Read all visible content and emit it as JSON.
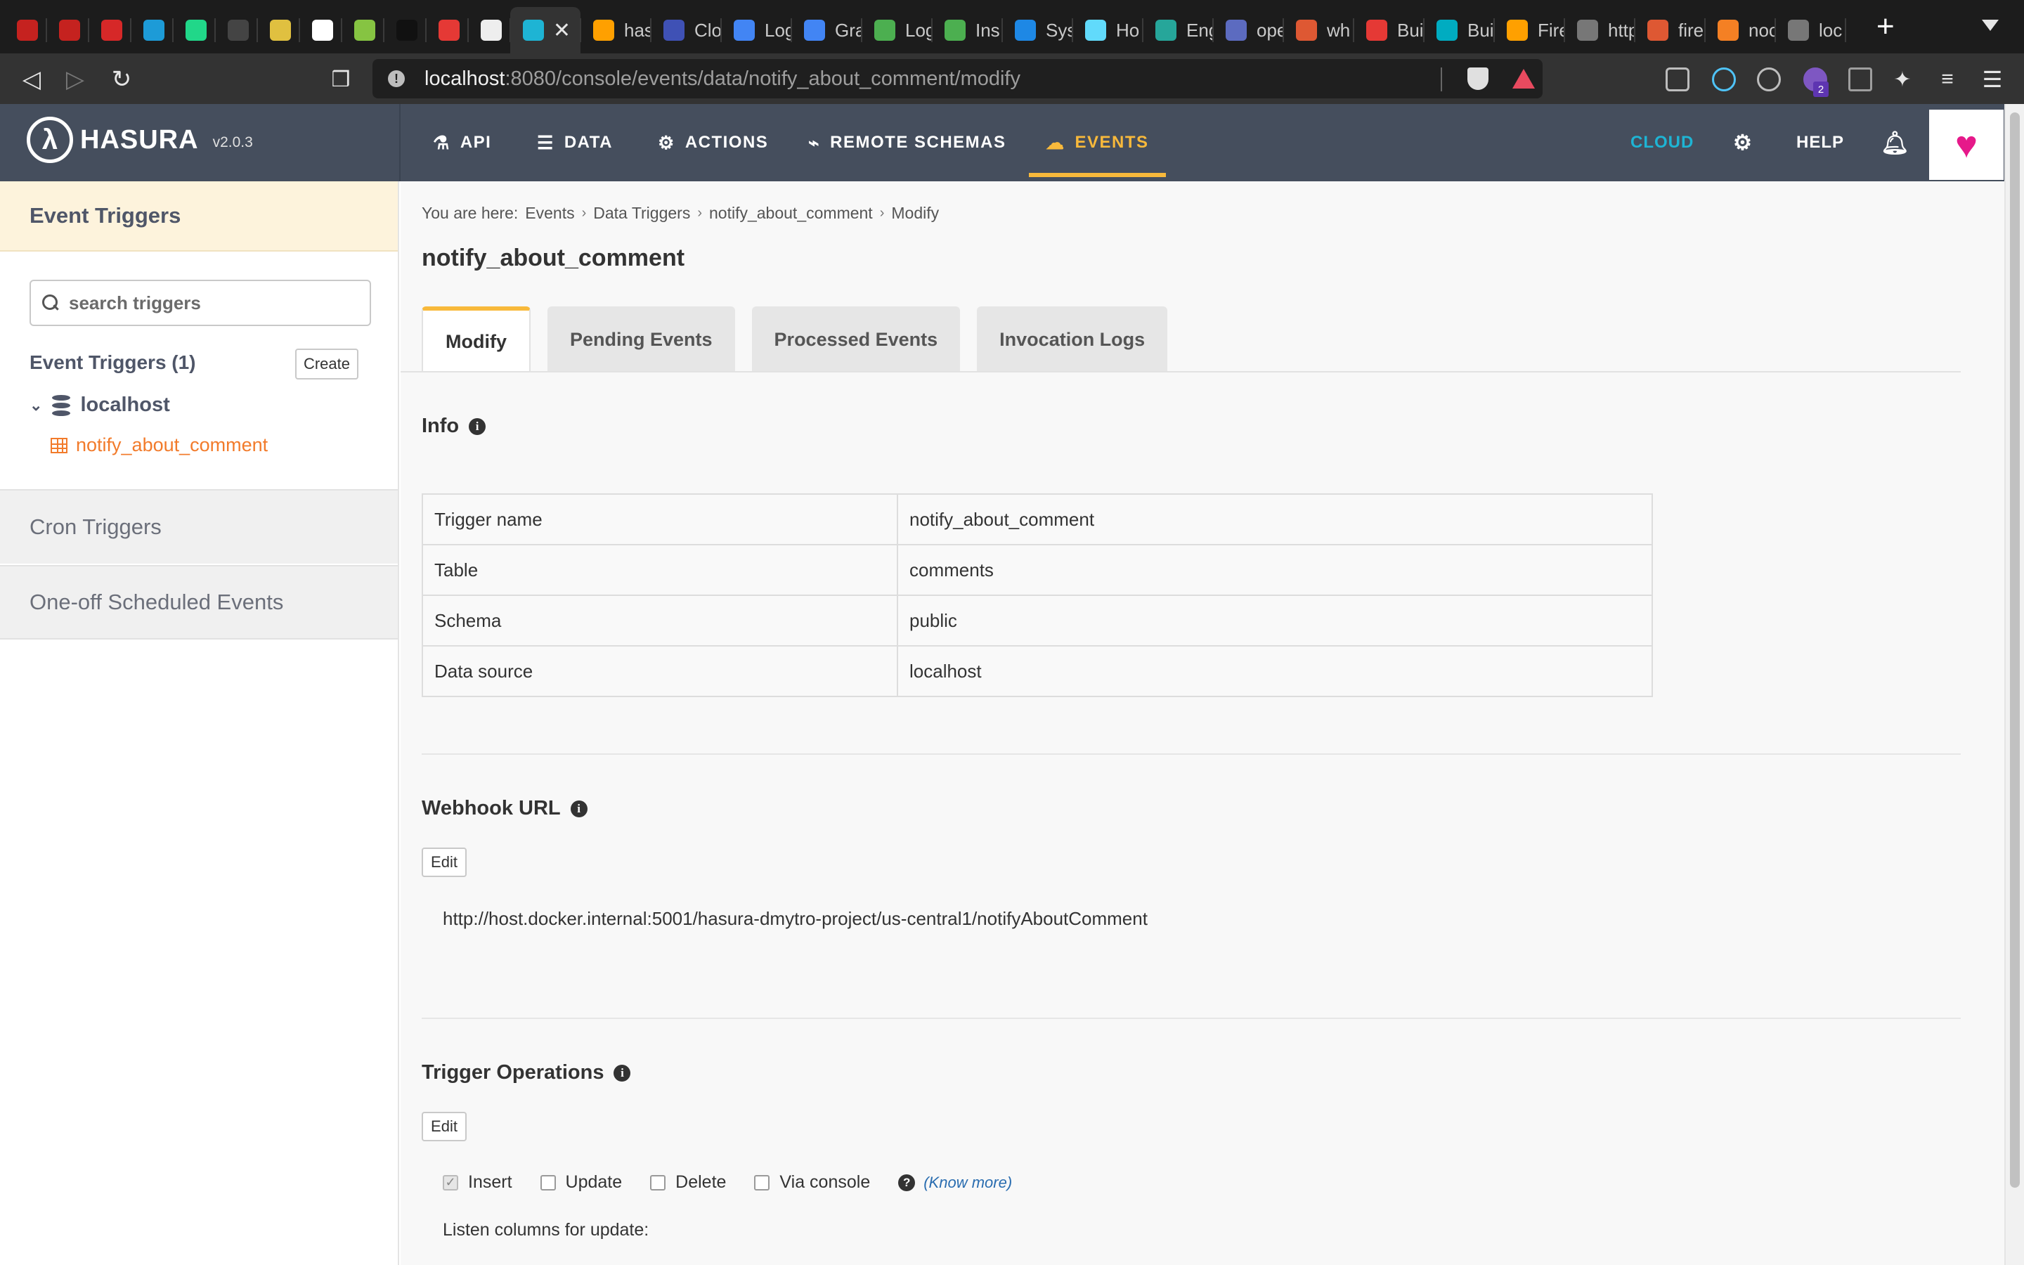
{
  "browser": {
    "tabs": [
      {
        "title": "",
        "favicon": "gmail-icon",
        "color": "#c5221f"
      },
      {
        "title": "",
        "favicon": "gmail-icon",
        "color": "#c5221f"
      },
      {
        "title": "",
        "favicon": "target-icon",
        "color": "#d62828"
      },
      {
        "title": "",
        "favicon": "upwork-icon",
        "color": "#1d9bd7"
      },
      {
        "title": "",
        "favicon": "pycharm-icon",
        "color": "#21d789"
      },
      {
        "title": "",
        "favicon": "circle-icon",
        "color": "#444444"
      },
      {
        "title": "",
        "favicon": "app-icon",
        "color": "#e0c040"
      },
      {
        "title": "",
        "favicon": "u-icon",
        "color": "#ffffff"
      },
      {
        "title": "",
        "favicon": "diamond-icon",
        "color": "#86c442"
      },
      {
        "title": "",
        "favicon": "jjs-icon",
        "color": "#111111"
      },
      {
        "title": "",
        "favicon": "heart-app-icon",
        "color": "#e53935"
      },
      {
        "title": "",
        "favicon": "github-icon",
        "color": "#eeeeee"
      },
      {
        "title": "",
        "favicon": "hasura-icon",
        "color": "#1eb4d4"
      },
      {
        "title": "has",
        "favicon": "firebase-icon",
        "color": "#ffa000"
      },
      {
        "title": "Clo",
        "favicon": "cloud-icon",
        "color": "#3f51b5"
      },
      {
        "title": "Log",
        "favicon": "c-icon",
        "color": "#4285f4"
      },
      {
        "title": "Gra",
        "favicon": "c-icon",
        "color": "#4285f4"
      },
      {
        "title": "Log",
        "favicon": "mongo-icon",
        "color": "#4caf50"
      },
      {
        "title": "Ins",
        "favicon": "mongo-icon",
        "color": "#4caf50"
      },
      {
        "title": "Sys",
        "favicon": "k-icon",
        "color": "#1e88e5"
      },
      {
        "title": "Ho",
        "favicon": "react-icon",
        "color": "#61dafb"
      },
      {
        "title": "Eng",
        "favicon": "link-icon",
        "color": "#26a69a"
      },
      {
        "title": "ope",
        "favicon": "grid-icon",
        "color": "#5c6bc0"
      },
      {
        "title": "wh",
        "favicon": "duck-icon",
        "color": "#de5833"
      },
      {
        "title": "Bui",
        "favicon": "dots-icon",
        "color": "#e53935"
      },
      {
        "title": "Bui",
        "favicon": "c-box-icon",
        "color": "#00acc1"
      },
      {
        "title": "Fire",
        "favicon": "firebase-icon",
        "color": "#ffa000"
      },
      {
        "title": "http",
        "favicon": "globe-icon",
        "color": "#777777"
      },
      {
        "title": "fire",
        "favicon": "duck-icon",
        "color": "#de5833"
      },
      {
        "title": "noc",
        "favicon": "stack-icon",
        "color": "#f48024"
      },
      {
        "title": "loc",
        "favicon": "globe-icon",
        "color": "#777777"
      }
    ],
    "url_host": "localhost",
    "url_path": ":8080/console/events/data/notify_about_comment/modify",
    "extension_badge": "2"
  },
  "header": {
    "logo_text": "HASURA",
    "version": "v2.0.3",
    "nav": [
      {
        "label": "API",
        "icon": "flask-icon"
      },
      {
        "label": "DATA",
        "icon": "database-icon"
      },
      {
        "label": "ACTIONS",
        "icon": "gears-icon"
      },
      {
        "label": "REMOTE SCHEMAS",
        "icon": "plug-icon"
      },
      {
        "label": "EVENTS",
        "icon": "cloud-icon"
      }
    ],
    "cloud_label": "CLOUD",
    "help_label": "HELP",
    "accent": "#f8b93b"
  },
  "sidebar": {
    "title": "Event Triggers",
    "search_placeholder": "search triggers",
    "count_label": "Event Triggers (1)",
    "create_label": "Create",
    "source": "localhost",
    "trigger": "notify_about_comment",
    "sections": [
      "Cron Triggers",
      "One-off Scheduled Events"
    ]
  },
  "main": {
    "breadcrumb_prefix": "You are here:",
    "breadcrumbs": [
      "Events",
      "Data Triggers",
      "notify_about_comment",
      "Modify"
    ],
    "title": "notify_about_comment",
    "tabs": [
      "Modify",
      "Pending Events",
      "Processed Events",
      "Invocation Logs"
    ],
    "info": {
      "title": "Info",
      "rows": [
        [
          "Trigger name",
          "notify_about_comment"
        ],
        [
          "Table",
          "comments"
        ],
        [
          "Schema",
          "public"
        ],
        [
          "Data source",
          "localhost"
        ]
      ]
    },
    "webhook": {
      "title": "Webhook URL",
      "edit_label": "Edit",
      "url": "http://host.docker.internal:5001/hasura-dmytro-project/us-central1/notifyAboutComment"
    },
    "operations": {
      "title": "Trigger Operations",
      "edit_label": "Edit",
      "items": [
        {
          "label": "Insert",
          "checked": true
        },
        {
          "label": "Update",
          "checked": false
        },
        {
          "label": "Delete",
          "checked": false
        },
        {
          "label": "Via console",
          "checked": false
        }
      ],
      "know_more": "(Know more)",
      "listen_columns": "Listen columns for update:"
    }
  }
}
